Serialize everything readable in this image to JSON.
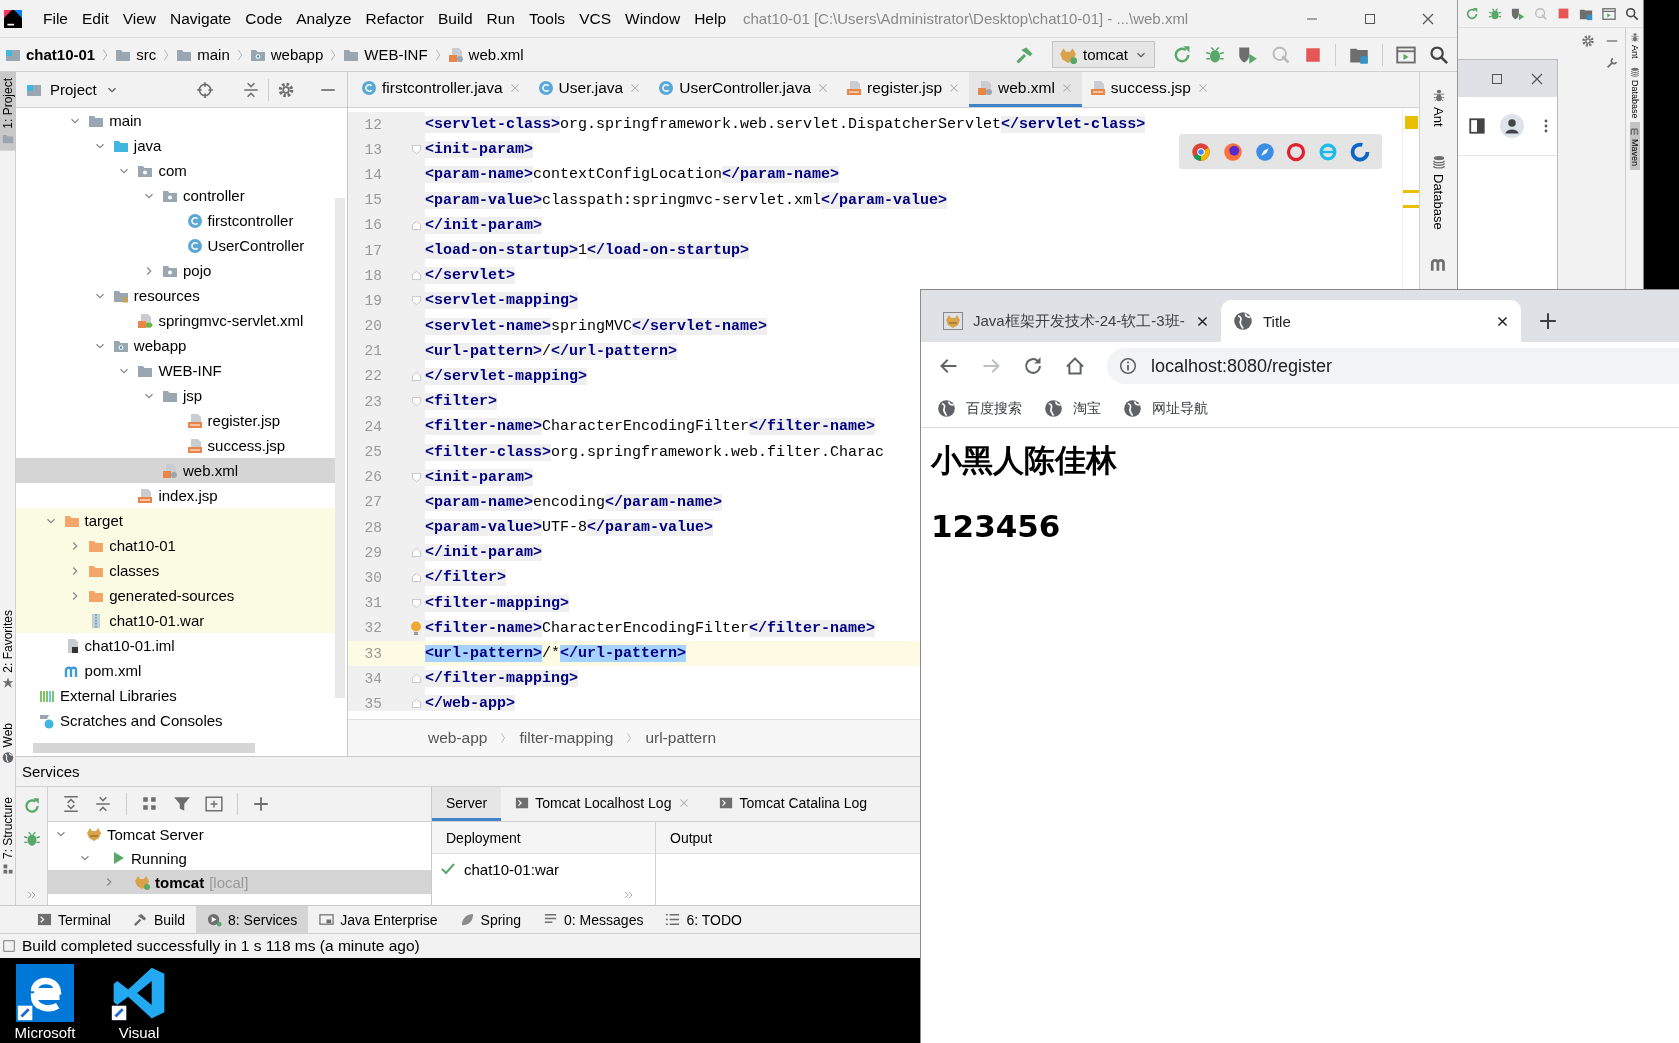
{
  "ide": {
    "title": "chat10-01 [C:\\Users\\Administrator\\Desktop\\chat10-01] - ...\\web.xml",
    "menu": [
      "File",
      "Edit",
      "View",
      "Navigate",
      "Code",
      "Analyze",
      "Refactor",
      "Build",
      "Run",
      "Tools",
      "VCS",
      "Window",
      "Help"
    ],
    "breadcrumb": [
      {
        "label": "chat10-01",
        "kind": "module"
      },
      {
        "label": "src",
        "kind": "folder"
      },
      {
        "label": "main",
        "kind": "folder"
      },
      {
        "label": "webapp",
        "kind": "webapp"
      },
      {
        "label": "WEB-INF",
        "kind": "folder"
      },
      {
        "label": "web.xml",
        "kind": "xml"
      }
    ],
    "run_config": "tomcat",
    "left_stripe": [
      {
        "label": "1: Project",
        "kind": "folder",
        "selected": true
      },
      {
        "label": "2: Favorites",
        "kind": "star",
        "selected": false
      },
      {
        "label": "Web",
        "kind": "globe",
        "selected": false
      },
      {
        "label": "7: Structure",
        "kind": "structure",
        "selected": false
      }
    ],
    "project_panel": {
      "title": "Project",
      "tree": [
        {
          "children": [
            {
              "children": [
                {
                  "label": "main",
                  "kind": "folder",
                  "expanded": true,
                  "selected": false,
                  "children": [
                    {
                      "label": "java",
                      "kind": "srcfolder",
                      "expanded": true,
                      "selected": false,
                      "children": [
                        {
                          "label": "com",
                          "kind": "package",
                          "expanded": true,
                          "selected": false,
                          "children": [
                            {
                              "label": "controller",
                              "kind": "package",
                              "expanded": true,
                              "selected": false,
                              "children": [
                                {
                                  "label": "firstcontroller",
                                  "kind": "class",
                                  "selected": false
                                },
                                {
                                  "label": "UserController",
                                  "kind": "class",
                                  "selected": false
                                }
                              ]
                            },
                            {
                              "label": "pojo",
                              "kind": "package",
                              "expanded": false,
                              "selected": false
                            }
                          ]
                        }
                      ]
                    },
                    {
                      "label": "resources",
                      "kind": "resources",
                      "expanded": true,
                      "selected": false,
                      "children": [
                        {
                          "label": "springmvc-servlet.xml",
                          "kind": "springxml",
                          "selected": false
                        }
                      ]
                    },
                    {
                      "label": "webapp",
                      "kind": "webapp",
                      "expanded": true,
                      "selected": false,
                      "children": [
                        {
                          "label": "WEB-INF",
                          "kind": "folder",
                          "expanded": true,
                          "selected": false,
                          "children": [
                            {
                              "label": "jsp",
                              "kind": "folder",
                              "expanded": true,
                              "selected": false,
                              "children": [
                                {
                                  "label": "register.jsp",
                                  "kind": "jsp",
                                  "selected": false
                                },
                                {
                                  "label": "success.jsp",
                                  "kind": "jsp",
                                  "selected": false
                                }
                              ]
                            },
                            {
                              "label": "web.xml",
                              "kind": "xml",
                              "selected": true
                            }
                          ]
                        },
                        {
                          "label": "index.jsp",
                          "kind": "jsp",
                          "selected": false
                        }
                      ]
                    }
                  ]
                }
              ]
            },
            {
              "label": "target",
              "kind": "excluded",
              "expanded": true,
              "excluded": true,
              "selected": false,
              "children": [
                {
                  "label": "chat10-01",
                  "kind": "excluded",
                  "expanded": false,
                  "selected": false
                },
                {
                  "label": "classes",
                  "kind": "excluded",
                  "expanded": false,
                  "selected": false
                },
                {
                  "label": "generated-sources",
                  "kind": "excluded",
                  "expanded": false,
                  "selected": false
                },
                {
                  "label": "chat10-01.war",
                  "kind": "war",
                  "selected": false
                }
              ]
            },
            {
              "label": "chat10-01.iml",
              "kind": "iml",
              "selected": false
            },
            {
              "label": "pom.xml",
              "kind": "maven",
              "selected": false
            }
          ]
        },
        {
          "label": "External Libraries",
          "kind": "libraries",
          "selected": false
        },
        {
          "label": "Scratches and Consoles",
          "kind": "scratches",
          "selected": false
        }
      ]
    },
    "editor": {
      "tabs": [
        {
          "label": "firstcontroller.java",
          "kind": "class",
          "selected": false
        },
        {
          "label": "User.java",
          "kind": "class",
          "selected": false
        },
        {
          "label": "UserController.java",
          "kind": "class",
          "selected": false
        },
        {
          "label": "register.jsp",
          "kind": "jsp",
          "selected": false
        },
        {
          "label": "web.xml",
          "kind": "xml",
          "selected": true
        },
        {
          "label": "success.jsp",
          "kind": "jsp",
          "selected": false
        }
      ],
      "lines": [
        {
          "number": "12",
          "text": "    <servlet-class>org.springframework.web.servlet.DispatcherServlet</servlet-class>",
          "kind": "plain",
          "current": false,
          "bulb": false
        },
        {
          "number": "13",
          "text": "    <init-param>",
          "kind": "fold-start",
          "current": false,
          "bulb": false
        },
        {
          "number": "14",
          "text": "      <param-name>contextConfigLocation</param-name>",
          "kind": "plain",
          "current": false,
          "bulb": false
        },
        {
          "number": "15",
          "text": "      <param-value>classpath:springmvc-servlet.xml</param-value>",
          "kind": "plain",
          "current": false,
          "bulb": false
        },
        {
          "number": "16",
          "text": "    </init-param>",
          "kind": "fold-end",
          "current": false,
          "bulb": false
        },
        {
          "number": "17",
          "text": "    <load-on-startup>1</load-on-startup>",
          "kind": "plain",
          "current": false,
          "bulb": false
        },
        {
          "number": "18",
          "text": "  </servlet>",
          "kind": "fold-end",
          "current": false,
          "bulb": false
        },
        {
          "number": "19",
          "text": "  <servlet-mapping>",
          "kind": "fold-start",
          "current": false,
          "bulb": false
        },
        {
          "number": "20",
          "text": "    <servlet-name>springMVC</servlet-name>",
          "kind": "plain",
          "current": false,
          "bulb": false
        },
        {
          "number": "21",
          "text": "    <url-pattern>/</url-pattern>",
          "kind": "plain",
          "current": false,
          "bulb": false
        },
        {
          "number": "22",
          "text": "  </servlet-mapping>",
          "kind": "fold-end",
          "current": false,
          "bulb": false
        },
        {
          "number": "23",
          "text": "  <filter>",
          "kind": "fold-start",
          "current": false,
          "bulb": false
        },
        {
          "number": "24",
          "text": "    <filter-name>CharacterEncodingFilter</filter-name>",
          "kind": "plain",
          "current": false,
          "bulb": false
        },
        {
          "number": "25",
          "text": "    <filter-class>org.springframework.web.filter.Charac",
          "kind": "plain",
          "current": false,
          "bulb": false
        },
        {
          "number": "26",
          "text": "    <init-param>",
          "kind": "fold-start",
          "current": false,
          "bulb": false
        },
        {
          "number": "27",
          "text": "      <param-name>encoding</param-name>",
          "kind": "plain",
          "current": false,
          "bulb": false
        },
        {
          "number": "28",
          "text": "      <param-value>UTF-8</param-value>",
          "kind": "plain",
          "current": false,
          "bulb": false
        },
        {
          "number": "29",
          "text": "    </init-param>",
          "kind": "fold-end",
          "current": false,
          "bulb": false
        },
        {
          "number": "30",
          "text": "  </filter>",
          "kind": "fold-end",
          "current": false,
          "bulb": false
        },
        {
          "number": "31",
          "text": "  <filter-mapping>",
          "kind": "fold-start",
          "current": false,
          "bulb": false
        },
        {
          "number": "32",
          "text": "    <filter-name>CharacterEncodingFilter</filter-name>",
          "kind": "plain",
          "current": false,
          "bulb": true
        },
        {
          "number": "33",
          "text": "    <url-pattern>/*</url-pattern>",
          "kind": "plain",
          "current": true,
          "bulb": false
        },
        {
          "number": "34",
          "text": "  </filter-mapping>",
          "kind": "fold-end",
          "current": false,
          "bulb": false
        },
        {
          "number": "35",
          "text": "</web-app>",
          "kind": "fold-end",
          "current": false,
          "bulb": false
        }
      ],
      "breadcrumb": [
        "web-app",
        "filter-mapping",
        "url-pattern"
      ]
    },
    "right_stripe": [
      {
        "label": "Ant",
        "kind": "ant"
      },
      {
        "label": "Database",
        "kind": "database"
      }
    ],
    "services": {
      "title": "Services",
      "tree": [
        {
          "label": "Tomcat Server",
          "kind": "server",
          "expanded": true,
          "selected": false,
          "children": [
            {
              "label": "Running",
              "kind": "status",
              "expanded": true,
              "selected": false,
              "children": [
                {
                  "label": "tomcat",
                  "detail": "[local]",
                  "kind": "instance",
                  "expanded": false,
                  "selected": true
                }
              ]
            }
          ]
        }
      ],
      "tabs": [
        {
          "label": "Server",
          "selected": true,
          "closable": false
        },
        {
          "label": "Tomcat Localhost Log",
          "selected": false,
          "closable": true
        },
        {
          "label": "Tomcat Catalina Log",
          "selected": false,
          "closable": false
        }
      ],
      "columns": [
        "Deployment",
        "Output"
      ],
      "deployments": [
        "chat10-01:war"
      ]
    },
    "tool_buttons": [
      {
        "label": "Terminal",
        "kind": "terminal",
        "selected": false
      },
      {
        "label": "Build",
        "kind": "hammer",
        "selected": false
      },
      {
        "label": "8: Services",
        "kind": "services",
        "selected": true
      },
      {
        "label": "Java Enterprise",
        "kind": "panel",
        "selected": false
      },
      {
        "label": "Spring",
        "kind": "leaf",
        "selected": false
      },
      {
        "label": "0: Messages",
        "kind": "messages",
        "selected": false
      },
      {
        "label": "6: TODO",
        "kind": "todo",
        "selected": false
      }
    ],
    "status": "Build completed successfully in 1 s 118 ms (a minute ago)"
  },
  "background_ide": {
    "stripe": [
      {
        "label": "Ant",
        "selected": false
      },
      {
        "label": "Database",
        "selected": false
      },
      {
        "label": "Maven",
        "selected": true
      }
    ]
  },
  "browser": {
    "tabs": [
      {
        "title": "Java框架开发技术-24-软工-3班-",
        "kind": "cat",
        "selected": false
      },
      {
        "title": "Title",
        "kind": "globe",
        "selected": true
      }
    ],
    "can_go_forward": false,
    "url": "localhost:8080/register",
    "bookmarks": [
      "百度搜索",
      "淘宝",
      "网址导航"
    ],
    "headings": [
      "小黑人陈佳林",
      "123456"
    ]
  },
  "desktop": {
    "shortcuts": [
      {
        "label": "Microsoft",
        "kind": "edge"
      },
      {
        "label": "Visual",
        "kind": "vscode"
      }
    ]
  }
}
